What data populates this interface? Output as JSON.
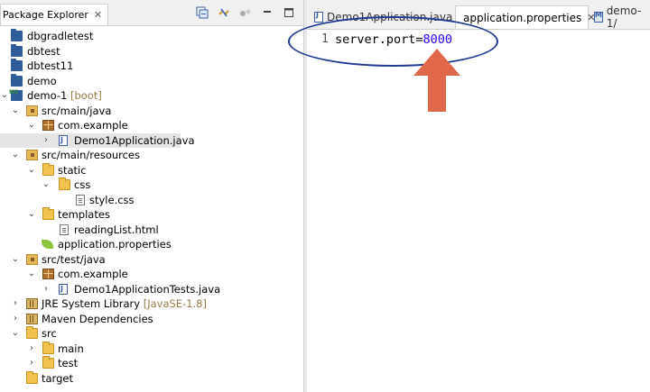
{
  "explorer": {
    "title": "Package Explorer",
    "items": [
      {
        "label": "dbgradletest",
        "decoration": ""
      },
      {
        "label": "dbtest",
        "decoration": ""
      },
      {
        "label": "dbtest11",
        "decoration": ""
      },
      {
        "label": "demo",
        "decoration": ""
      },
      {
        "label": "demo-1",
        "decoration": "[boot]"
      },
      {
        "label": "src/main/java",
        "decoration": ""
      },
      {
        "label": "com.example",
        "decoration": ""
      },
      {
        "label": "Demo1Application.java",
        "decoration": ""
      },
      {
        "label": "src/main/resources",
        "decoration": ""
      },
      {
        "label": "static",
        "decoration": ""
      },
      {
        "label": "css",
        "decoration": ""
      },
      {
        "label": "style.css",
        "decoration": ""
      },
      {
        "label": "templates",
        "decoration": ""
      },
      {
        "label": "readingList.html",
        "decoration": ""
      },
      {
        "label": "application.properties",
        "decoration": ""
      },
      {
        "label": "src/test/java",
        "decoration": ""
      },
      {
        "label": "com.example",
        "decoration": ""
      },
      {
        "label": "Demo1ApplicationTests.java",
        "decoration": ""
      },
      {
        "label": "JRE System Library",
        "decoration": "[JavaSE-1.8]"
      },
      {
        "label": "Maven Dependencies",
        "decoration": ""
      },
      {
        "label": "src",
        "decoration": ""
      },
      {
        "label": "main",
        "decoration": ""
      },
      {
        "label": "test",
        "decoration": ""
      },
      {
        "label": "target",
        "decoration": ""
      }
    ]
  },
  "editor": {
    "tabs": [
      {
        "label": "Demo1Application.java"
      },
      {
        "label": "application.properties"
      },
      {
        "label": "demo-1/"
      }
    ],
    "line_number": "1",
    "code_key": "server.port",
    "code_equals": "=",
    "code_value": "8000"
  },
  "colors": {
    "annotation_ellipse": "#1f3a93",
    "annotation_arrow": "#e0674a"
  }
}
